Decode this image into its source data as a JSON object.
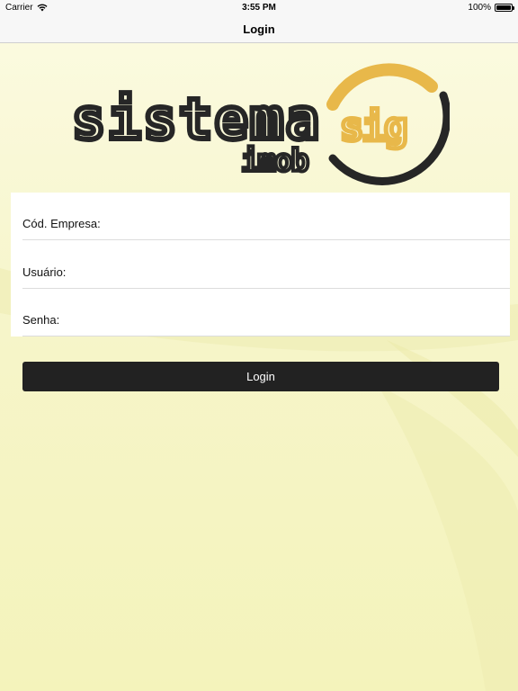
{
  "status_bar": {
    "carrier": "Carrier",
    "time": "3:55 PM",
    "battery": "100%",
    "battery_level": 1.0,
    "wifi_icon": "wifi-icon",
    "battery_icon": "battery-icon"
  },
  "nav": {
    "title": "Login"
  },
  "logo": {
    "text_main": "sistema",
    "text_badge": "sig",
    "text_sub": "imob",
    "colors": {
      "dark": "#262626",
      "accent": "#e8b84a"
    }
  },
  "form": {
    "fields": [
      {
        "label": "Cód. Empresa:",
        "value": ""
      },
      {
        "label": "Usuário:",
        "value": ""
      },
      {
        "label": "Senha:",
        "value": ""
      }
    ]
  },
  "actions": {
    "login_label": "Login"
  },
  "colors": {
    "background": "#f7f6c2",
    "button": "#222222",
    "button_text": "#ffffff"
  }
}
